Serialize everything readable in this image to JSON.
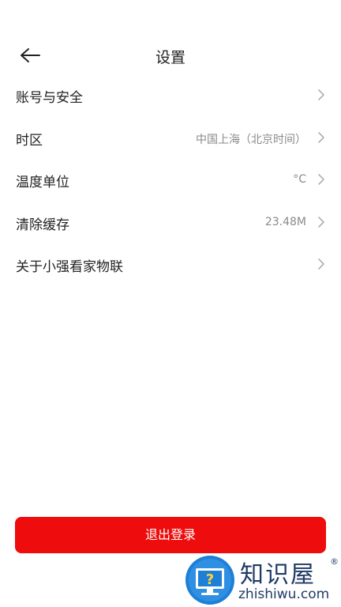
{
  "header": {
    "title": "设置",
    "back_icon": "arrow-left-icon"
  },
  "settings": {
    "items": [
      {
        "label": "账号与安全",
        "value": ""
      },
      {
        "label": "时区",
        "value": "中国上海（北京时间）"
      },
      {
        "label": "温度单位",
        "value": "°C"
      },
      {
        "label": "清除缓存",
        "value": "23.48M"
      },
      {
        "label": "关于小强看家物联",
        "value": ""
      }
    ],
    "chevron_icon": "chevron-right-icon"
  },
  "logout": {
    "label": "退出登录",
    "color": "#ee0c0c"
  },
  "watermark": {
    "title": "知识屋",
    "domain": "zhishiwu.com",
    "registered": "®"
  },
  "colors": {
    "text": "#222222",
    "secondary_text": "#8a8a8a",
    "accent": "#ee0c0c"
  }
}
